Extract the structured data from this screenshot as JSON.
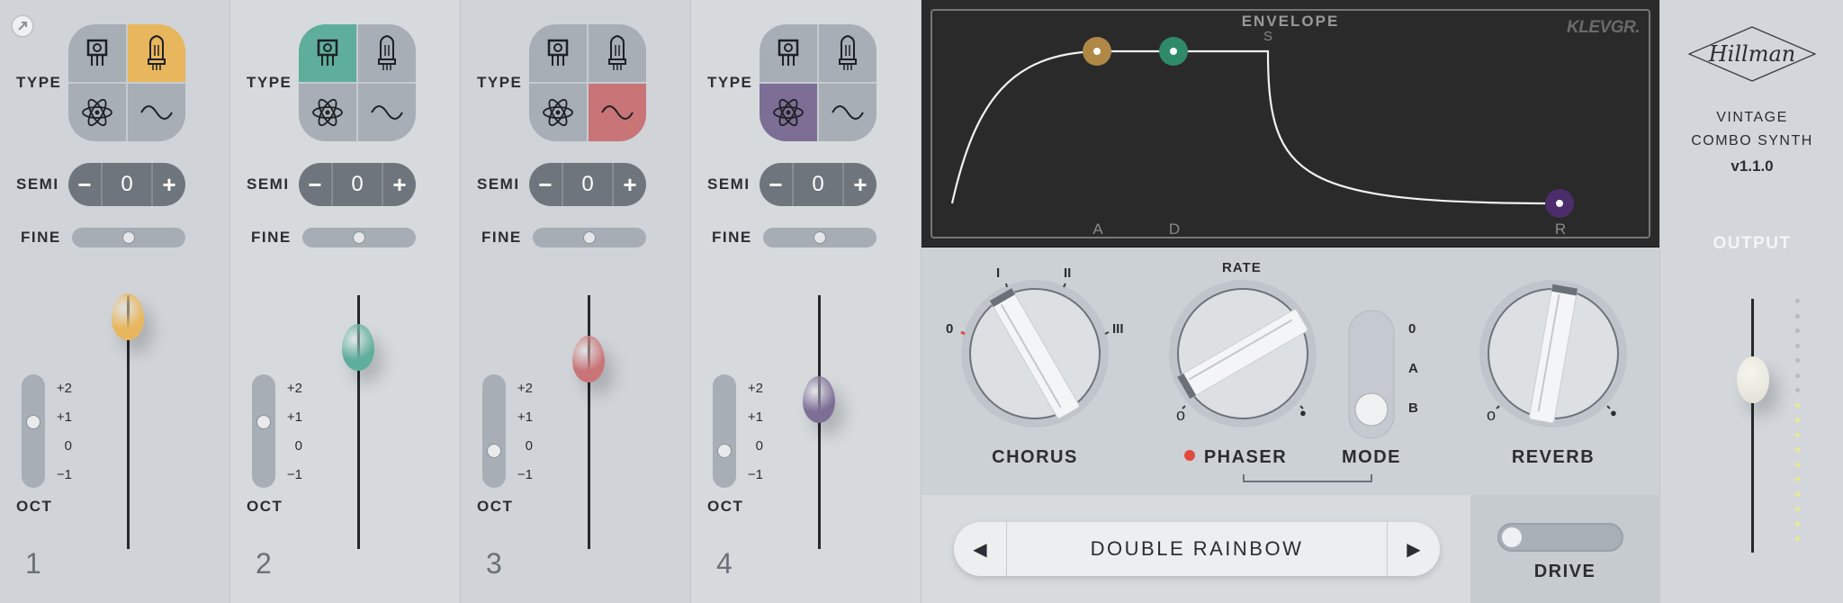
{
  "channels": [
    {
      "type_label": "TYPE",
      "semi_label": "SEMI",
      "semi_minus": "−",
      "semi_value": "0",
      "semi_plus": "+",
      "fine_label": "FINE",
      "oct_label": "OCT",
      "oct_values": [
        "+2",
        "+1",
        "0",
        "−1"
      ],
      "oct_selected": "+1",
      "number": "1",
      "selected_type": "tube",
      "color": "#e8b65c"
    },
    {
      "type_label": "TYPE",
      "semi_label": "SEMI",
      "semi_minus": "−",
      "semi_value": "0",
      "semi_plus": "+",
      "fine_label": "FINE",
      "oct_label": "OCT",
      "oct_values": [
        "+2",
        "+1",
        "0",
        "−1"
      ],
      "oct_selected": "+1",
      "number": "2",
      "selected_type": "transistor",
      "color": "#5fae9b"
    },
    {
      "type_label": "TYPE",
      "semi_label": "SEMI",
      "semi_minus": "−",
      "semi_value": "0",
      "semi_plus": "+",
      "fine_label": "FINE",
      "oct_label": "OCT",
      "oct_values": [
        "+2",
        "+1",
        "0",
        "−1"
      ],
      "oct_selected": "0",
      "number": "3",
      "selected_type": "sine",
      "color": "#c97477"
    },
    {
      "type_label": "TYPE",
      "semi_label": "SEMI",
      "semi_minus": "−",
      "semi_value": "0",
      "semi_plus": "+",
      "fine_label": "FINE",
      "oct_label": "OCT",
      "oct_values": [
        "+2",
        "+1",
        "0",
        "−1"
      ],
      "oct_selected": "0",
      "number": "4",
      "selected_type": "atom",
      "color": "#7d6e95"
    }
  ],
  "envelope": {
    "title": "ENVELOPE",
    "brand": "KLEVGR.",
    "labels": {
      "a": "A",
      "d": "D",
      "s": "S",
      "r": "R"
    },
    "colors": {
      "a": "#b08846",
      "d": "#2f8a6a",
      "r": "#4a2d6a"
    }
  },
  "effects": {
    "chorus": {
      "label": "CHORUS",
      "marks": [
        "0",
        "I",
        "II",
        "III"
      ]
    },
    "phaser": {
      "label": "PHASER",
      "rate_label": "RATE",
      "min": "o",
      "max": "●",
      "led_color": "#e24a3f"
    },
    "mode": {
      "label": "MODE",
      "options": [
        "0",
        "A",
        "B"
      ]
    },
    "reverb": {
      "label": "REVERB",
      "min": "o",
      "max": "●"
    }
  },
  "preset": {
    "prev": "◀",
    "name": "DOUBLE RAINBOW",
    "next": "▶"
  },
  "drive": {
    "label": "DRIVE"
  },
  "brand": {
    "logo": "Hillman",
    "line1": "VINTAGE",
    "line2": "COMBO SYNTH",
    "version": "v1.1.0"
  },
  "output": {
    "label": "OUTPUT",
    "meter_lit": 10,
    "meter_total": 17
  }
}
